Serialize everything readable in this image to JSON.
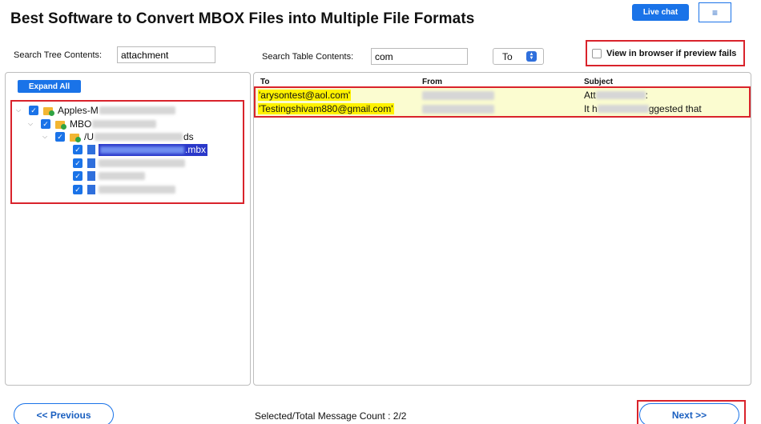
{
  "page": {
    "title": "Best Software to Convert MBOX Files into Multiple File Formats"
  },
  "header": {
    "live_chat": "Live chat",
    "menu_icon": "≡"
  },
  "search": {
    "tree_label": "Search Tree Contents:",
    "tree_value": "attachment",
    "table_label": "Search Table Contents:",
    "table_value": "com",
    "field_select": "To"
  },
  "options": {
    "view_in_browser": "View in browser if preview fails"
  },
  "tree": {
    "expand_all": "Expand All",
    "root": "Apples-M",
    "mbox_node": "MBO",
    "path_prefix": "/U",
    "path_suffix": "ds",
    "selected_file_ext": ".mbx"
  },
  "table": {
    "columns": [
      "To",
      "From",
      "Subject"
    ],
    "rows": [
      {
        "to": "'arysontest@aol.com'",
        "from": "Shivam Dwivedi",
        "subject_start": "Att",
        "subject_end": ":"
      },
      {
        "to": "'Testingshivam880@gmail.com'",
        "from": "Shivam Dwivedi",
        "subject_start": "It h",
        "subject_end": "ggested that"
      }
    ]
  },
  "footer": {
    "previous": "<< Previous",
    "count": "Selected/Total Message Count : 2/2",
    "next": "Next >>"
  },
  "colors": {
    "accent": "#1a73e8",
    "highlight_box": "#d9232b",
    "row_highlight": "#fbfcd0",
    "search_match": "#fff200"
  }
}
